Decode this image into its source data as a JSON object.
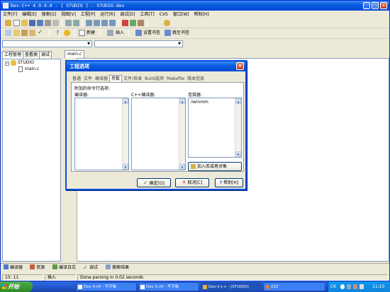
{
  "window": {
    "title": "Dev-C++ 4.9.9.0  - [ STUDIO ] - STUDIO.dev"
  },
  "menu": [
    "文件[F]",
    "编辑[E]",
    "搜索[S]",
    "视图[V]",
    "工程[P]",
    "运行[R]",
    "调试[D]",
    "工具[T]",
    "CVS",
    "窗口[W]",
    "帮助[H]"
  ],
  "toolbar": {
    "new_label": "新建",
    "insert_label": "插入",
    "bookmark_set_label": "设置书签",
    "bookmark_goto_label": "跳至书签"
  },
  "left_tabs": [
    "工程管理",
    "查看类",
    "调试"
  ],
  "tree": {
    "project": "STUDIO",
    "file": "main.c"
  },
  "editor_tab": "main.c",
  "dialog": {
    "title": "工程选项",
    "tabs": [
      "普通",
      "文件",
      "编译器",
      "参数",
      "文件/目录",
      "Build选项",
      "Makefile",
      "版本信息"
    ],
    "selected_tab": "参数",
    "section_label": "附加的命令行选项:",
    "compiler_label": "编译器:",
    "cpp_compiler_label": "C++编译器:",
    "linker_label": "连接器:",
    "linker_value": "-lwinmm",
    "add_lib_button": "加入库或者对象",
    "ok_button": "确定[O]",
    "cancel_button": "取消[C]",
    "help_button": "帮助[H]"
  },
  "bottom_tabs": [
    "编译器",
    "资源",
    "编译日志",
    "调试",
    "搜索结果"
  ],
  "status": {
    "position": "15: 11",
    "mode": "插入",
    "message": "Done parsing in 0.02 seconds"
  },
  "taskbar": {
    "start": "开始",
    "tasks": [
      "Dev 4.rtf - 写字板",
      "Dev 3.rtf - 写字板",
      "Dev-C++ - [STUDIO]",
      "015"
    ],
    "lang": "CK",
    "clock": "11:10"
  },
  "colors": {
    "titlebar": "#0a5fe0",
    "taskbar": "#245edb",
    "start": "#3c9a36",
    "face": "#ece9d8"
  }
}
